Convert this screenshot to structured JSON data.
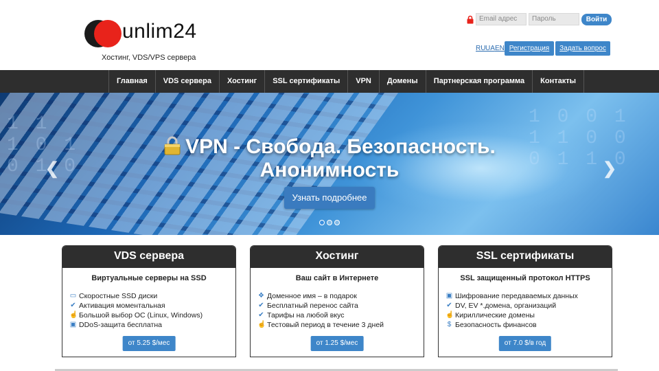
{
  "header": {
    "logo_text": "unlim24",
    "tagline": "Хостинг, VDS/VPS сервера",
    "email_placeholder": "Email адрес",
    "password_placeholder": "Пароль",
    "login_label": "Войти",
    "languages": [
      "RU",
      "UA",
      "EN"
    ],
    "register_label": "Регистрация",
    "ask_label": "Задать вопрос",
    "brand_colors": {
      "accent": "#3e86c9",
      "logo_red": "#e8231b",
      "logo_dark": "#1b1b1b"
    }
  },
  "nav": {
    "items": [
      "Главная",
      "VDS сервера",
      "Хостинг",
      "SSL сертификаты",
      "VPN",
      "Домены",
      "Партнерская программа",
      "Контакты"
    ]
  },
  "hero": {
    "title_line1": "VPN - Свобода. Безопасность.",
    "title_line2": "Анонимность",
    "button_label": "Узнать подробнее",
    "slides_count": 3,
    "active_slide": 1,
    "prev_icon": "chevron-left-icon",
    "next_icon": "chevron-right-icon"
  },
  "cards": [
    {
      "title": "VDS сервера",
      "subtitle": "Виртуальные серверы на SSD",
      "features": [
        {
          "icon": "disk-icon",
          "text": "Скоростные SSD диски"
        },
        {
          "icon": "check-icon",
          "text": "Активация моментальная"
        },
        {
          "icon": "thumbs-up-icon",
          "text": "Большой выбор ОС (Linux, Windows)"
        },
        {
          "icon": "lock-icon",
          "text": "DDoS-защита бесплатна"
        }
      ],
      "price": "от 5.25 $/мес"
    },
    {
      "title": "Хостинг",
      "subtitle": "Ваш сайт в Интернете",
      "features": [
        {
          "icon": "grid-icon",
          "text": "Доменное имя – в подарок"
        },
        {
          "icon": "check-icon",
          "text": "Бесплатный перенос сайта"
        },
        {
          "icon": "check-icon",
          "text": "Тарифы на любой вкус"
        },
        {
          "icon": "thumbs-up-icon",
          "text": "Тестовый период в течение 3 дней"
        }
      ],
      "price": "от 1.25 $/мес"
    },
    {
      "title": "SSL сертификаты",
      "subtitle": "SSL защищенный протокол HTTPS",
      "features": [
        {
          "icon": "lock-icon",
          "text": "Шифрование передаваемых данных"
        },
        {
          "icon": "check-icon",
          "text": "DV, EV *.домена, организаций"
        },
        {
          "icon": "thumbs-up-icon",
          "text": "Кириллические домены"
        },
        {
          "icon": "dollar-icon",
          "text": "Безопасность финансов"
        }
      ],
      "price": "от 7.0 $/в год"
    }
  ]
}
